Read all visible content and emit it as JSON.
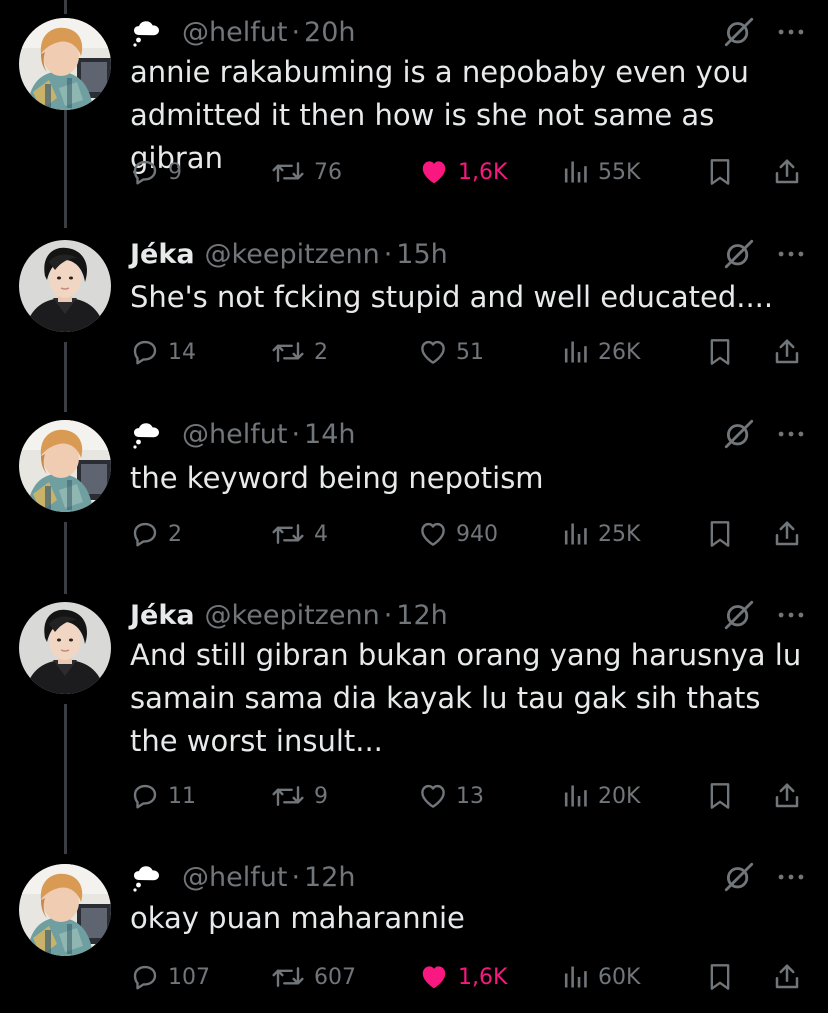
{
  "tweets": [
    {
      "name": "",
      "handle": "@helfut",
      "time": "20h",
      "avatar": "avatar-helfut",
      "has_cloud": true,
      "text": "annie rakabuming is a nepobaby even you admitted it then how is she not same as gibran",
      "replies": "9",
      "reposts": "76",
      "likes": "1,6K",
      "liked": true,
      "views": "55K"
    },
    {
      "name": "Jéka",
      "handle": "@keepitzenn",
      "time": "15h",
      "avatar": "avatar-keepitzenn",
      "has_cloud": false,
      "text": "She's not fcking stupid and well educated....",
      "replies": "14",
      "reposts": "2",
      "likes": "51",
      "liked": false,
      "views": "26K"
    },
    {
      "name": "",
      "handle": "@helfut",
      "time": "14h",
      "avatar": "avatar-helfut",
      "has_cloud": true,
      "text": "the keyword being nepotism",
      "replies": "2",
      "reposts": "4",
      "likes": "940",
      "liked": false,
      "views": "25K"
    },
    {
      "name": "Jéka",
      "handle": "@keepitzenn",
      "time": "12h",
      "avatar": "avatar-keepitzenn",
      "has_cloud": false,
      "text": "And still gibran bukan orang yang harusnya lu samain sama dia kayak lu tau gak sih thats the worst insult...",
      "replies": "11",
      "reposts": "9",
      "likes": "13",
      "liked": false,
      "views": "20K"
    },
    {
      "name": "",
      "handle": "@helfut",
      "time": "12h",
      "avatar": "avatar-helfut",
      "has_cloud": true,
      "text": "okay puan maharannie",
      "replies": "107",
      "reposts": "607",
      "likes": "1,6K",
      "liked": true,
      "views": "60K"
    }
  ],
  "colors": {
    "background": "#000000",
    "text": "#e7e9ea",
    "muted": "#71767b",
    "like_active": "#f91880",
    "thread_line": "#3a3d41"
  },
  "icons": {
    "reply": "reply-icon",
    "repost": "repost-icon",
    "like": "heart-icon",
    "views": "views-icon",
    "bookmark": "bookmark-icon",
    "share": "share-icon",
    "grok": "grok-icon",
    "more": "more-icon",
    "cloud": "thought-cloud-icon"
  }
}
